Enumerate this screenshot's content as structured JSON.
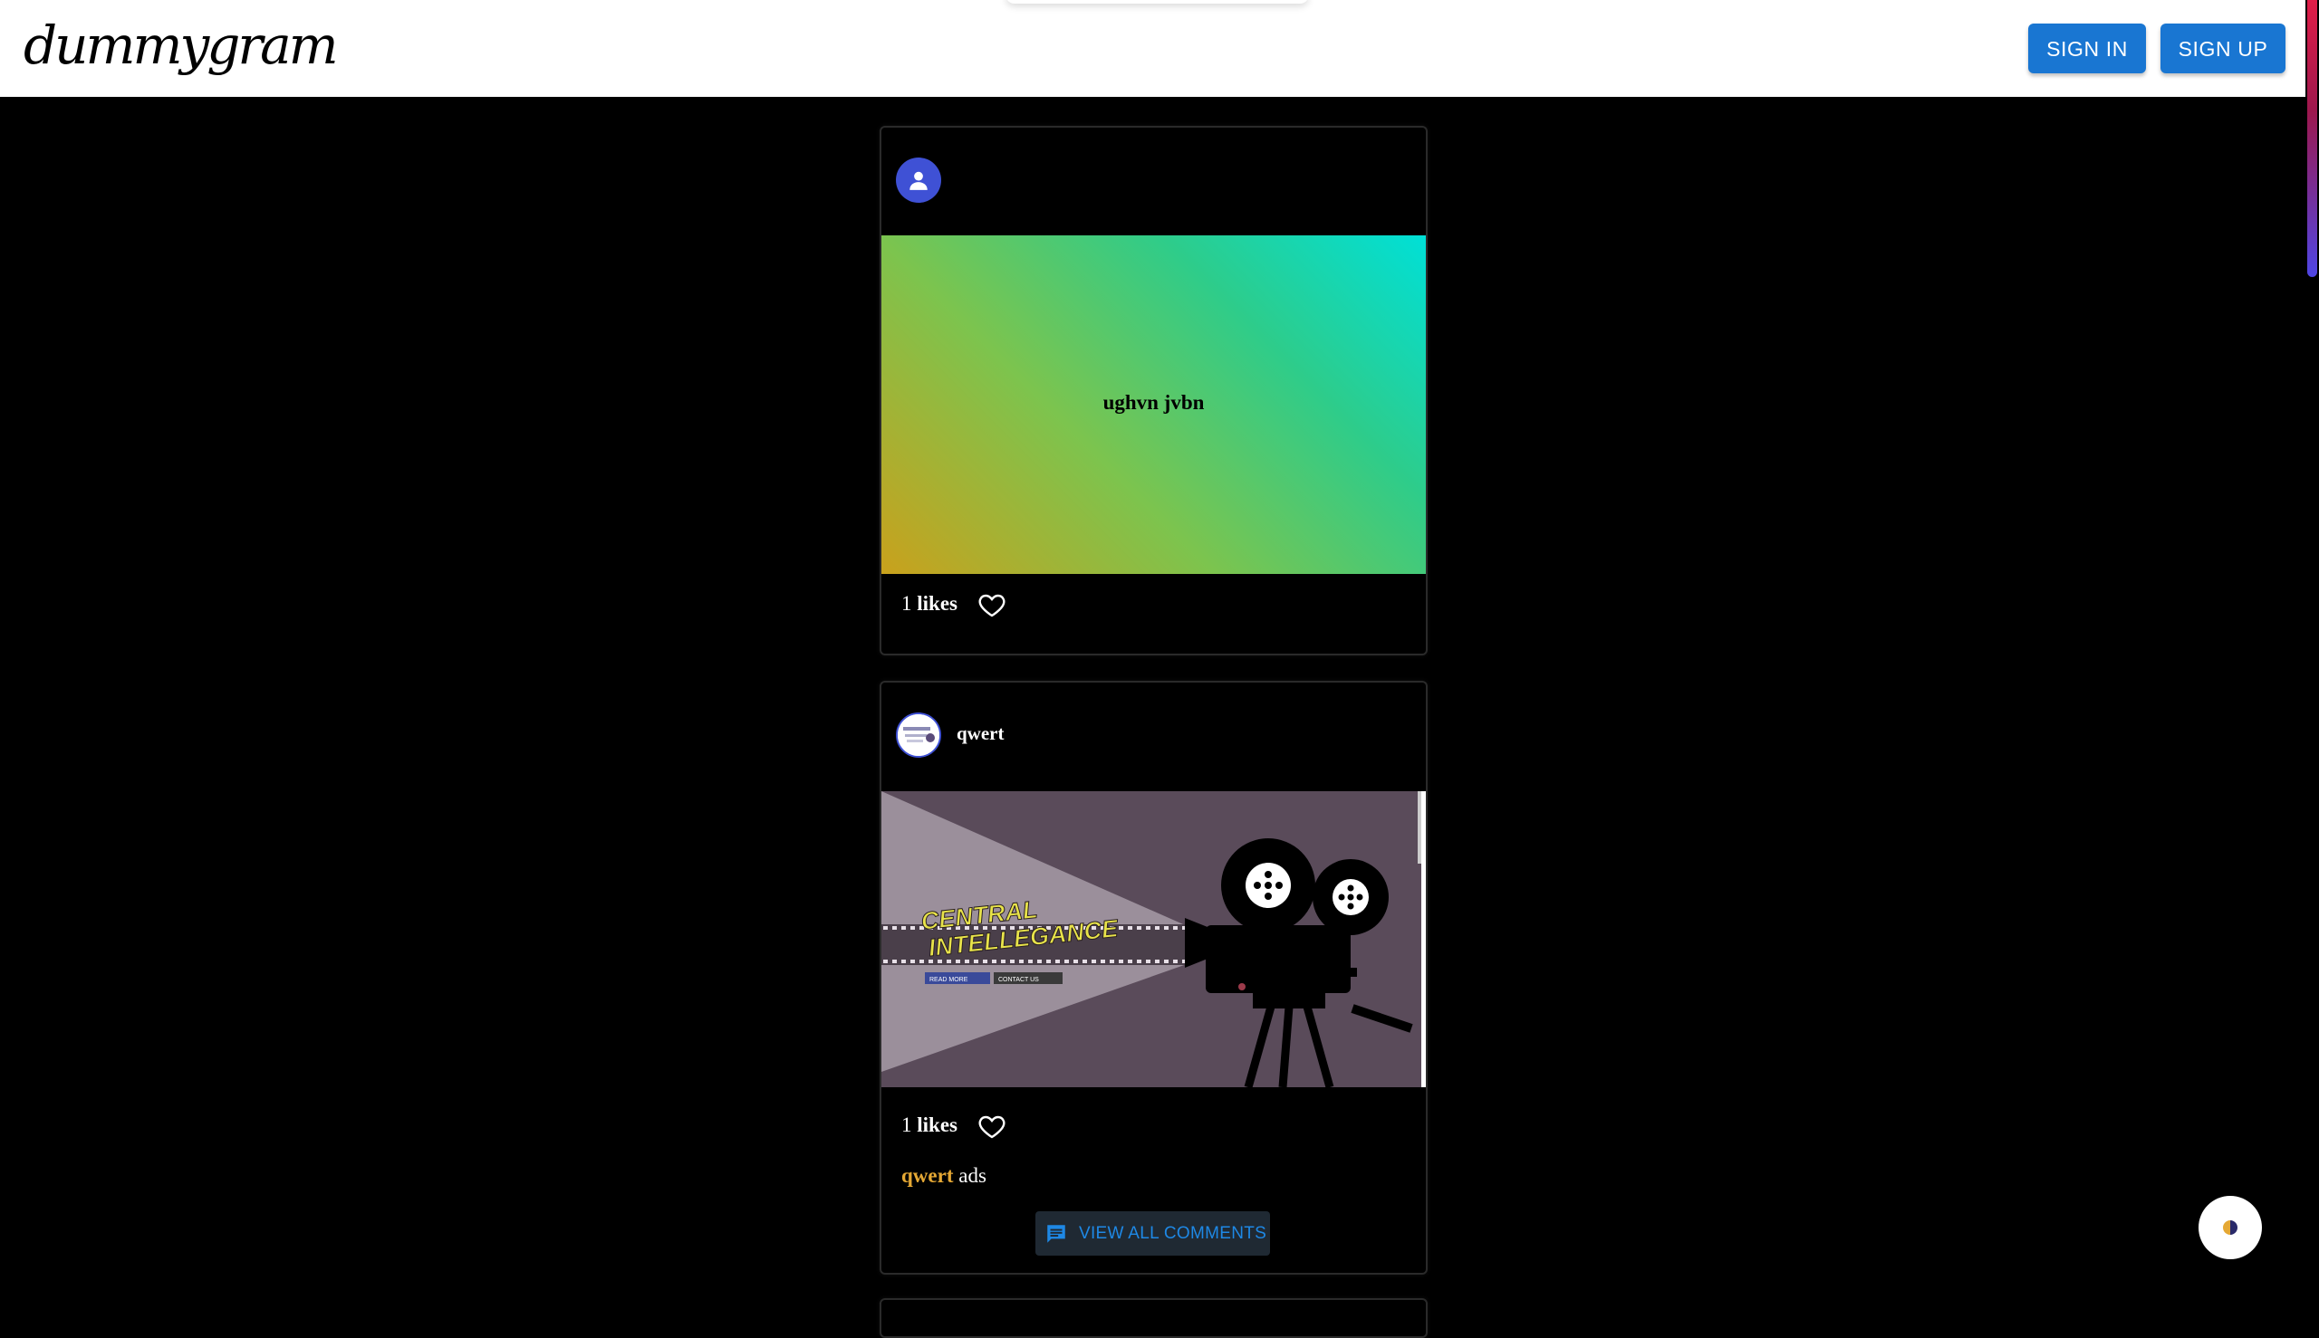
{
  "header": {
    "logo": "dummygram",
    "sign_in": "SIGN IN",
    "sign_up": "SIGN UP"
  },
  "posts": [
    {
      "username": "",
      "image_text": "ughvn jvbn",
      "likes_count": "1",
      "likes_label": "likes"
    },
    {
      "username": "qwert",
      "image_texts": {
        "headline_line1": "CENTRAL",
        "headline_line2": "INTELLEGANCE",
        "read_more": "READ MORE",
        "contact_us": "CONTACT US"
      },
      "likes_count": "1",
      "likes_label": "likes",
      "caption_user": "qwert",
      "caption_text": "ads",
      "view_comments": "VIEW ALL COMMENTS"
    }
  ],
  "colors": {
    "accent": "#1976d2",
    "caption_user": "#e5a834",
    "avatar": "#3f51d5"
  },
  "icons": [
    "person-icon",
    "heart-outline-icon",
    "comment-icon",
    "theme-toggle-icon"
  ]
}
